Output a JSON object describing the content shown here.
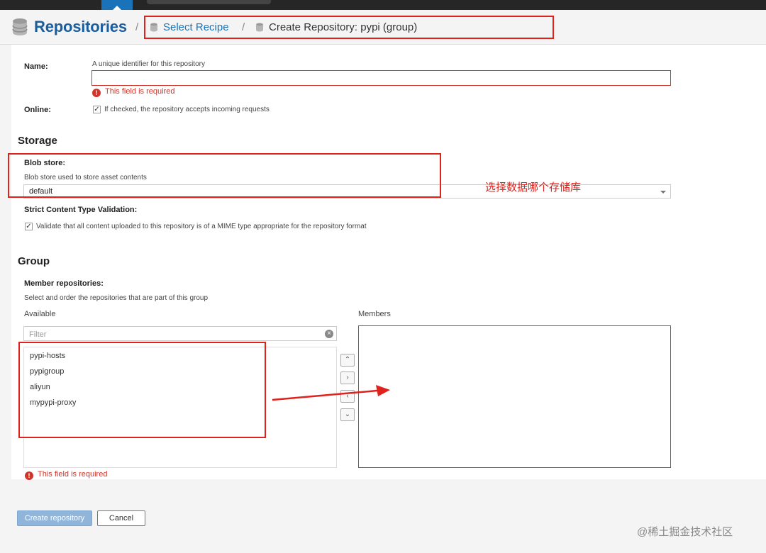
{
  "header": {
    "title": "Repositories",
    "separator": "/",
    "breadcrumb_link": "Select Recipe",
    "breadcrumb_current": "Create Repository: pypi (group)"
  },
  "form": {
    "name": {
      "label": "Name:",
      "help": "A unique identifier for this repository",
      "value": "",
      "error": "This field is required"
    },
    "online": {
      "label": "Online:",
      "checked": true,
      "help": "If checked, the repository accepts incoming requests"
    },
    "storage": {
      "heading": "Storage",
      "blob_store_label": "Blob store:",
      "blob_store_help": "Blob store used to store asset contents",
      "blob_store_value": "default",
      "strict_label": "Strict Content Type Validation:",
      "strict_checked": true,
      "strict_help": "Validate that all content uploaded to this repository is of a MIME type appropriate for the repository format"
    },
    "group": {
      "heading": "Group",
      "members_label": "Member repositories:",
      "members_help": "Select and order the repositories that are part of this group",
      "available_label": "Available",
      "members_column_label": "Members",
      "filter_placeholder": "Filter",
      "available_items": [
        "pypi-hosts",
        "pypigroup",
        "aliyun",
        "mypypi-proxy"
      ],
      "members_items": [],
      "error": "This field is required"
    }
  },
  "buttons": {
    "create": "Create repository",
    "cancel": "Cancel"
  },
  "annotations": {
    "blob_store_note": "选择数据哪个存储库",
    "color": "#e0221c"
  },
  "watermark": "@稀土掘金技术社区",
  "colors": {
    "brand_blue": "#1a5e9e",
    "error_red": "#d0352a",
    "primary_button": "#8fb5da"
  }
}
